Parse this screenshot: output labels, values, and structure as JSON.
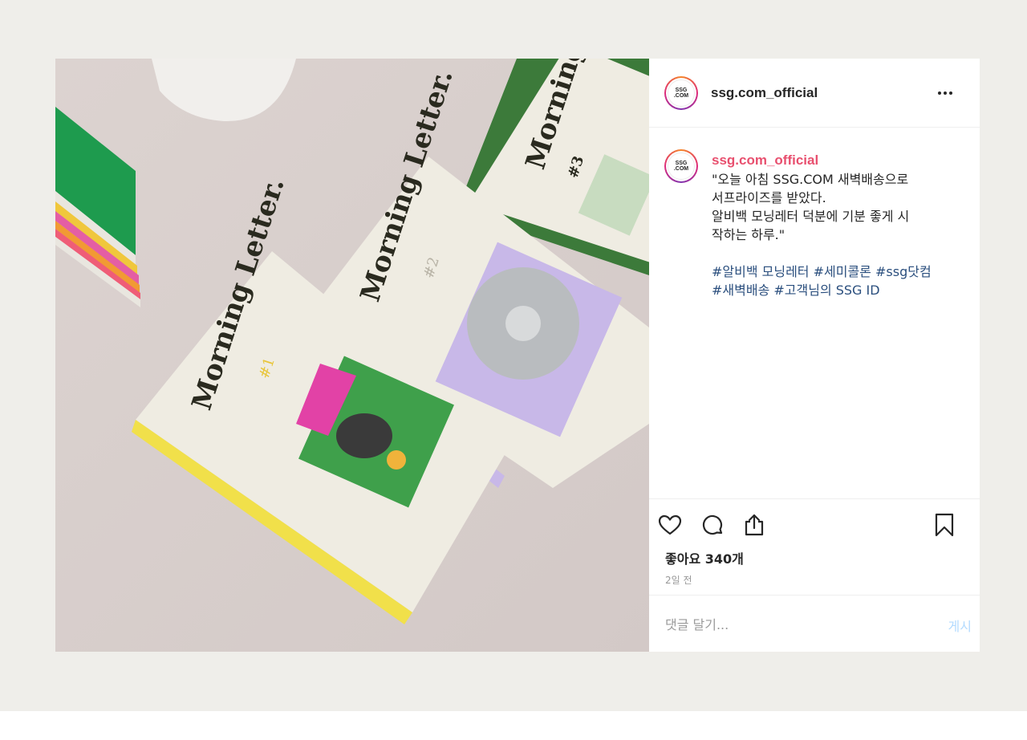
{
  "account": {
    "username": "ssg.com_official",
    "avatar_text_line1": "SSG",
    "avatar_text_line2": ".COM"
  },
  "header": {
    "more_icon": "more-horizontal-icon"
  },
  "photo": {
    "book_title": "Morning Letter.",
    "issues": [
      "#1",
      "#2",
      "#3"
    ]
  },
  "caption": {
    "username": "ssg.com_official",
    "text": "\"오늘 아침  SSG.COM 새벽배송으로\n서프라이즈를 받았다.\n알비백 모닝레터 덕분에 기분 좋게 시\n작하는 하루.\"",
    "hashtags_line1": " #알비백 모닝레터 #세미콜론 #ssg닷컴",
    "hashtags_line2": "#새벽배송 #고객님의 SSG ID"
  },
  "actions": {
    "like_icon": "heart-icon",
    "comment_icon": "comment-icon",
    "share_icon": "share-icon",
    "save_icon": "bookmark-icon",
    "likes_text": "좋아요 340개",
    "time_text": "2일 전"
  },
  "comment": {
    "placeholder": "댓글 달기...",
    "post_label": "게시",
    "post_color": "#b3dbff"
  },
  "colors": {
    "frame_bg": "#efeeea",
    "caption_user": "#e8506f",
    "hashtag": "#2b4f7e"
  }
}
